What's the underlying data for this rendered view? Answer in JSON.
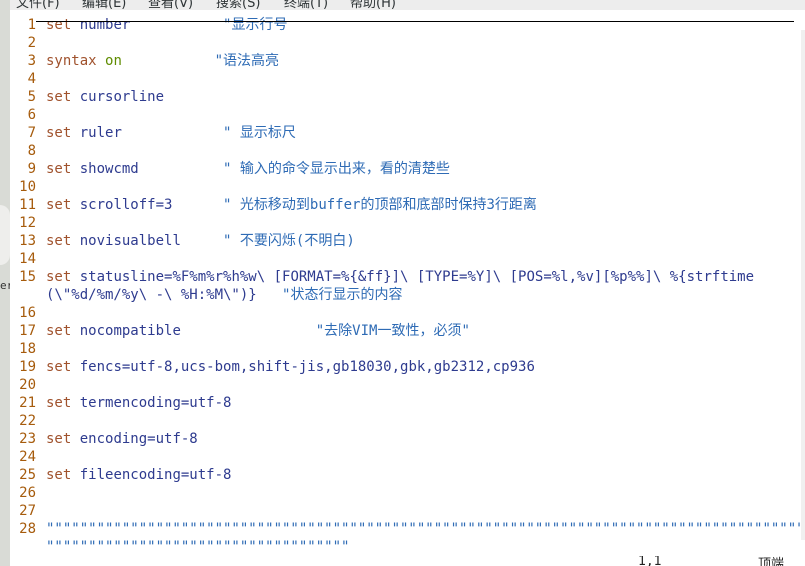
{
  "menubar": {
    "items": [
      "文件(F)",
      "编辑(E)",
      "查看(V)",
      "搜索(S)",
      "终端(T)",
      "帮助(H)"
    ]
  },
  "left_fragment": "er",
  "lines": [
    {
      "n": "1",
      "kw": "set",
      "opt": "number",
      "pad": "           ",
      "cm": "\"显示行号"
    },
    {
      "n": "2",
      "kw": "",
      "opt": "",
      "pad": "",
      "cm": ""
    },
    {
      "n": "3",
      "kw": "syntax",
      "on": "on",
      "pad": "           ",
      "cm": "\"语法高亮"
    },
    {
      "n": "4",
      "kw": "",
      "opt": "",
      "pad": "",
      "cm": ""
    },
    {
      "n": "5",
      "kw": "set",
      "opt": "cursorline",
      "pad": "",
      "cm": ""
    },
    {
      "n": "6",
      "kw": "",
      "opt": "",
      "pad": "",
      "cm": ""
    },
    {
      "n": "7",
      "kw": "set",
      "opt": "ruler",
      "pad": "            ",
      "cm": "\" 显示标尺"
    },
    {
      "n": "8",
      "kw": "",
      "opt": "",
      "pad": "",
      "cm": ""
    },
    {
      "n": "9",
      "kw": "set",
      "opt": "showcmd",
      "pad": "          ",
      "cm": "\" 输入的命令显示出来，看的清楚些"
    },
    {
      "n": "10",
      "kw": "",
      "opt": "",
      "pad": "",
      "cm": ""
    },
    {
      "n": "11",
      "kw": "set",
      "opt": "scrolloff=3",
      "pad": "      ",
      "cm": "\" 光标移动到buffer的顶部和底部时保持3行距离"
    },
    {
      "n": "12",
      "kw": "",
      "opt": "",
      "pad": "",
      "cm": ""
    },
    {
      "n": "13",
      "kw": "set",
      "opt": "novisualbell",
      "pad": "     ",
      "cm": "\" 不要闪烁(不明白)"
    },
    {
      "n": "14",
      "kw": "",
      "opt": "",
      "pad": "",
      "cm": ""
    },
    {
      "n": "15",
      "kw": "set",
      "opt": "statusline=%F%m%r%h%w\\ [FORMAT=%{&ff}]\\ [TYPE=%Y]\\ [POS=%l,%v][%p%%]\\ %{strftime",
      "pad": "",
      "cm": ""
    },
    {
      "n": "",
      "kw": "",
      "opt": "(\\\"%d/%m/%y\\ -\\ %H:%M\\\")}",
      "pad": "   ",
      "cm": "\"状态行显示的内容"
    },
    {
      "n": "16",
      "kw": "",
      "opt": "",
      "pad": "",
      "cm": ""
    },
    {
      "n": "17",
      "kw": "set",
      "opt": "nocompatible",
      "pad": "                ",
      "cm": "\"去除VIM一致性，必须\""
    },
    {
      "n": "18",
      "kw": "",
      "opt": "",
      "pad": "",
      "cm": ""
    },
    {
      "n": "19",
      "kw": "set",
      "opt": "fencs=utf-8,ucs-bom,shift-jis,gb18030,gbk,gb2312,cp936",
      "pad": "",
      "cm": ""
    },
    {
      "n": "20",
      "kw": "",
      "opt": "",
      "pad": "",
      "cm": ""
    },
    {
      "n": "21",
      "kw": "set",
      "opt": "termencoding=utf-8",
      "pad": "",
      "cm": ""
    },
    {
      "n": "22",
      "kw": "",
      "opt": "",
      "pad": "",
      "cm": ""
    },
    {
      "n": "23",
      "kw": "set",
      "opt": "encoding=utf-8",
      "pad": "",
      "cm": ""
    },
    {
      "n": "24",
      "kw": "",
      "opt": "",
      "pad": "",
      "cm": ""
    },
    {
      "n": "25",
      "kw": "set",
      "opt": "fileencoding=utf-8",
      "pad": "",
      "cm": ""
    },
    {
      "n": "26",
      "kw": "",
      "opt": "",
      "pad": "",
      "cm": ""
    },
    {
      "n": "27",
      "kw": "",
      "opt": "",
      "pad": "",
      "cm": ""
    },
    {
      "n": "28",
      "kw": "",
      "opt": "",
      "pad": "",
      "cm": "\"\"\"\"\"\"\"\"\"\"\"\"\"\"\"\"\"\"\"\"\"\"\"\"\"\"\"\"\"\"\"\"\"\"\"\"\"\"\"\"\"\"\"\"\"\"\"\"\"\"\"\"\"\"\"\"\"\"\"\"\"\"\"\"\"\"\"\"\"\"\"\"\"\"\"\"\"\"\"\"\"\"\"\"\"\"\"\"\"\"\"\"\"\"\"\"\"\"\"\"\"\"\"\"\"\"\"\"\"\"\"\"\"\"\"\"\"\"\"\"\"\"\"\"\"\"\"\"\"\"\"\"\"\"\"\"\"\"\"\"\"\"\"\"\"\"\"\"\"\"\"\"\"\"\"\"\"\"\"\"\"\"\"\"\"\"\"\"\"\"\"\"\"\"\"\"\"\"\"\"\"\"\"\"\"\"\"\"\"\"\"\"\"\"\"\"\"\"\"\"\"\"\"\"\"\"\""
    },
    {
      "n": "",
      "kw": "",
      "opt": "",
      "pad": "",
      "cm": "\"\"\"\"\"\"\"\"\"\"\"\"\"\"\"\"\"\"\"\"\"\"\"\"\"\"\"\"\"\"\"\"\"\"\"\""
    }
  ],
  "status": {
    "position": "1,1",
    "scroll": "顶端"
  }
}
